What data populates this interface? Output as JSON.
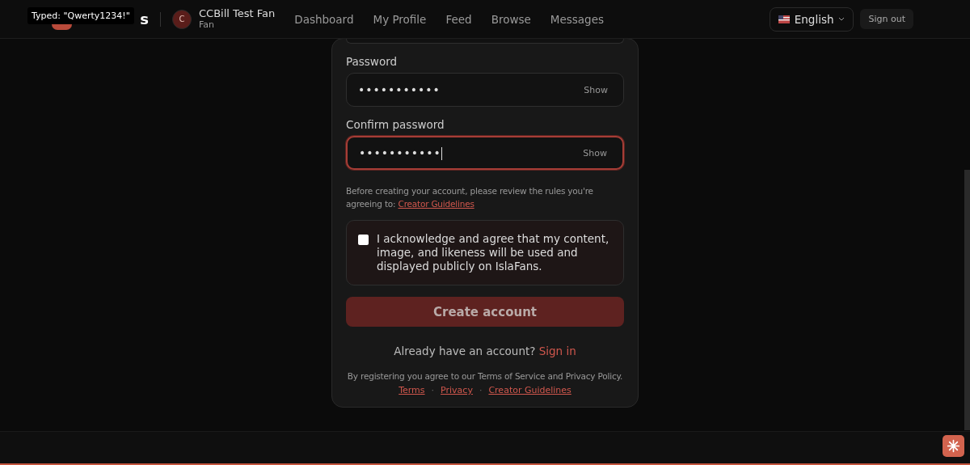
{
  "tooltip": {
    "text": "Typed: \"Qwerty1234!\""
  },
  "header": {
    "logo_visible_text": "s",
    "user": {
      "initial": "C",
      "name": "CCBill Test Fan",
      "role": "Fan"
    },
    "nav": [
      "Dashboard",
      "My Profile",
      "Feed",
      "Browse",
      "Messages"
    ],
    "language": "English",
    "sign_out": "Sign out"
  },
  "form": {
    "fields": [
      {
        "label": "Password",
        "value": "•••••••••••",
        "toggle": "Show",
        "focused": false
      },
      {
        "label": "Confirm password",
        "value": "•••••••••••",
        "toggle": "Show",
        "focused": true
      }
    ],
    "notice": "Before creating your account, please review the rules you're agreeing to:",
    "notice_link": "Creator Guidelines",
    "consent": {
      "text": "I acknowledge and agree that my content, image, and likeness will be used and displayed publicly on IslaFans.",
      "checked": false
    },
    "submit": "Create account",
    "signin_prompt": "Already have an account?",
    "signin_link": "Sign in",
    "legal": "By registering you agree to our Terms of Service and Privacy Policy.",
    "legal_links": [
      "Terms",
      "Privacy",
      "Creator Guidelines"
    ],
    "legal_separator": "·"
  }
}
